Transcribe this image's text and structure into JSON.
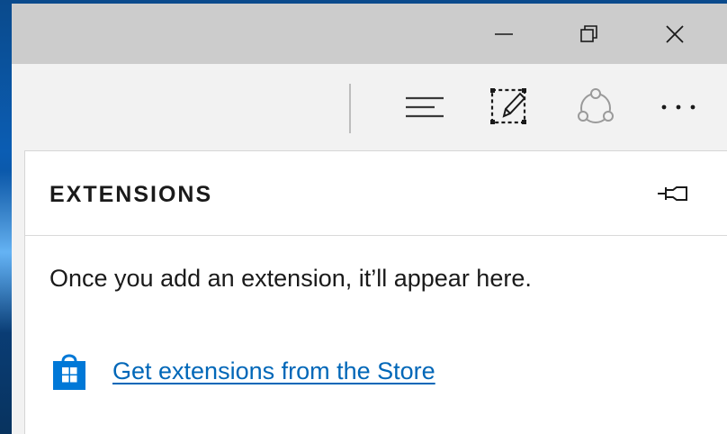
{
  "window": {
    "controls": {
      "minimize_icon": "minimize-icon",
      "restore_icon": "restore-icon",
      "close_icon": "close-icon"
    }
  },
  "toolbar": {
    "icons": [
      "hub-icon",
      "web-note-icon",
      "share-icon",
      "more-icon"
    ]
  },
  "extensions_panel": {
    "title": "EXTENSIONS",
    "pin_icon": "pin-icon",
    "empty_message": "Once you add an extension, it’ll appear here.",
    "store_link_label": "Get extensions from the Store",
    "store_icon": "store-icon"
  },
  "colors": {
    "titlebar": "#cccccc",
    "toolbar": "#f2f2f2",
    "link": "#0067b8",
    "store_icon": "#0078d7",
    "desktop": "#0b5db3"
  }
}
